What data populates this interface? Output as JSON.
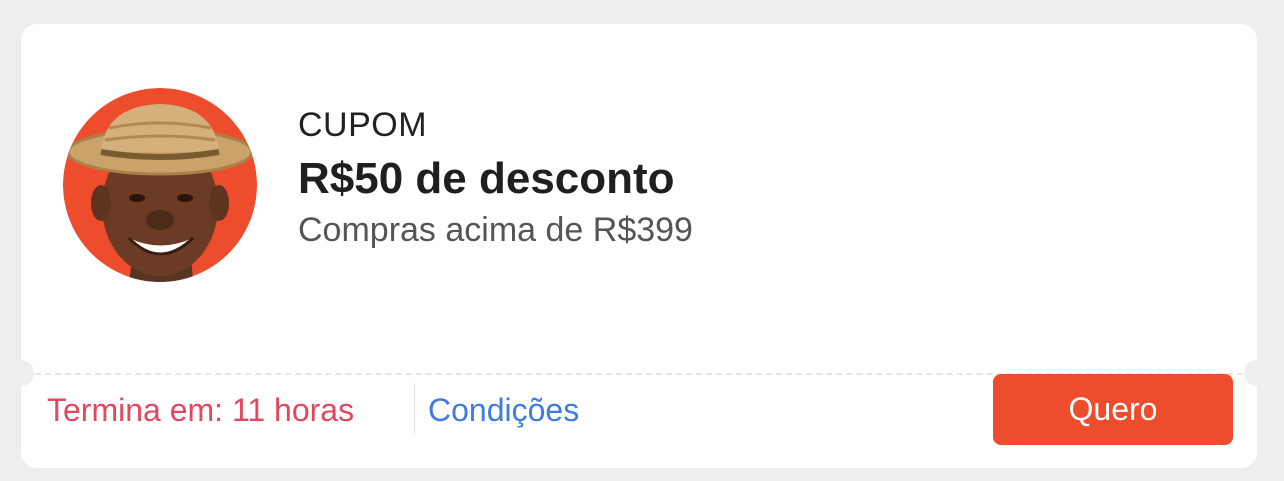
{
  "coupon": {
    "type_label": "CUPOM",
    "title": "R$50 de desconto",
    "subtitle": "Compras acima de R$399",
    "expiry": "Termina em: 11 horas",
    "conditions_link": "Condições",
    "claim_button": "Quero",
    "avatar_icon": "person-with-straw-hat-avatar"
  },
  "colors": {
    "page_background": "#eeeeee",
    "card_background": "#ffffff",
    "accent": "#ee4d2d",
    "expiry_text": "#e0485e",
    "link": "#3f7be0"
  }
}
